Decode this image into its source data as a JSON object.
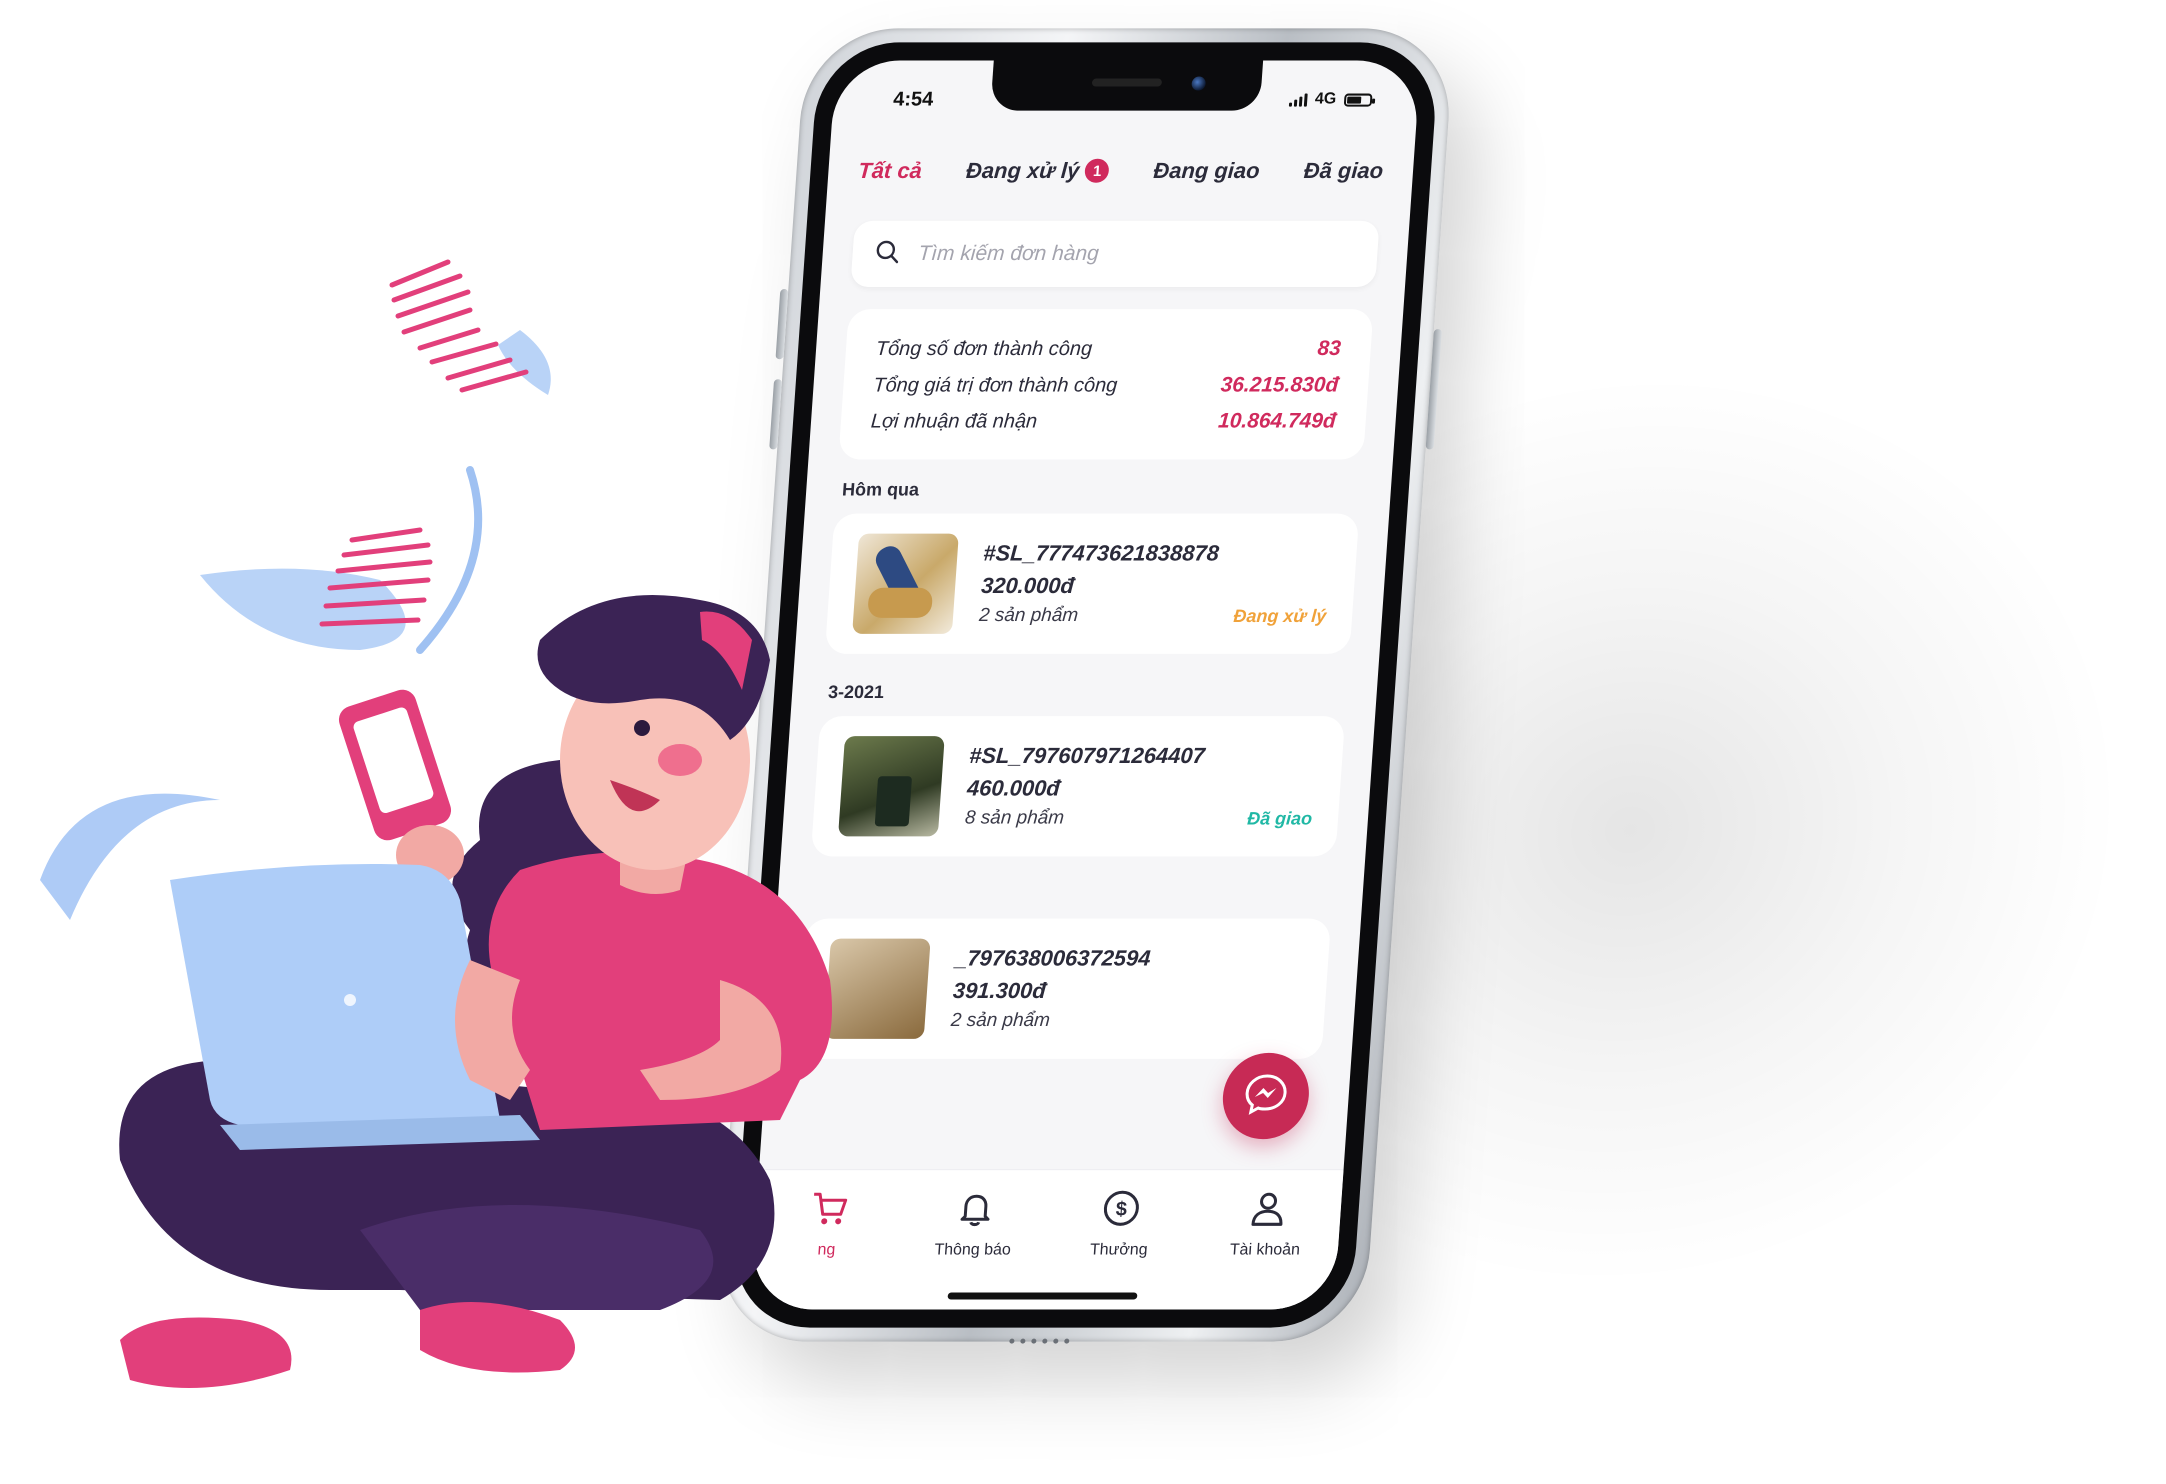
{
  "status_bar": {
    "time": "4:54",
    "network": "4G",
    "battery_level": 0.7
  },
  "tabs": [
    {
      "label": "Tất cả",
      "active": true
    },
    {
      "label": "Đang xử lý",
      "badge": "1"
    },
    {
      "label": "Đang giao"
    },
    {
      "label": "Đã giao"
    }
  ],
  "search": {
    "placeholder": "Tìm kiếm đơn hàng",
    "icon": "search-icon"
  },
  "summary": {
    "rows": [
      {
        "label": "Tổng số đơn thành công",
        "value": "83"
      },
      {
        "label": "Tổng giá trị đơn thành công",
        "value": "36.215.830đ"
      },
      {
        "label": "Lợi nhuận đã nhận",
        "value": "10.864.749đ"
      }
    ]
  },
  "sections": {
    "yesterday": "Hôm qua",
    "date_partial": "3-2021"
  },
  "orders": [
    {
      "code": "#SL_777473621838878",
      "price": "320.000đ",
      "items": "2 sản phẩm",
      "status": "Đang xử lý"
    },
    {
      "code": "#SL_797607971264407",
      "price": "460.000đ",
      "items": "8 sản phẩm",
      "status": "Đã giao"
    },
    {
      "code": "_797638006372594",
      "price": "391.300đ",
      "items": "2 sản phẩm",
      "status": ""
    }
  ],
  "bottom_nav": [
    {
      "label": "ng",
      "icon": "cart-icon"
    },
    {
      "label": "Thông báo",
      "icon": "bell-icon"
    },
    {
      "label": "Thưởng",
      "icon": "dollar-coin-icon"
    },
    {
      "label": "Tài khoản",
      "icon": "user-icon"
    }
  ],
  "colors": {
    "brand": "#d02a5d",
    "processing": "#f0a23a",
    "delivered": "#20b8a5",
    "laptop": "#aecdf8",
    "shirt": "#e23f7b",
    "hair": "#3b2355"
  }
}
